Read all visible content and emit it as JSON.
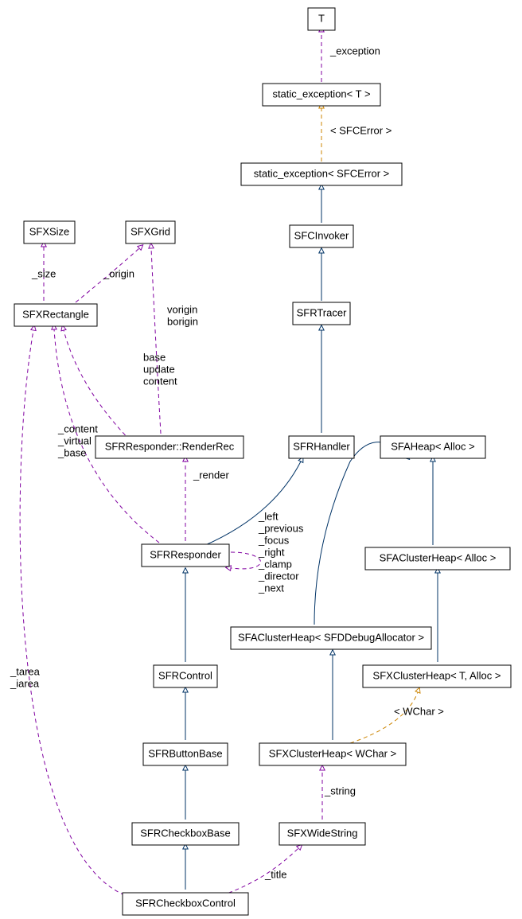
{
  "diagram": {
    "meta": {
      "type": "class-collaboration",
      "title": "SFRCheckboxControl collaboration diagram"
    },
    "nodes": {
      "T": {
        "label": "T"
      },
      "staticExT": {
        "label": "static_exception< T >"
      },
      "staticExSFC": {
        "label": "static_exception< SFCError >"
      },
      "SFCInvoker": {
        "label": "SFCInvoker"
      },
      "SFRTracer": {
        "label": "SFRTracer"
      },
      "SFRHandler": {
        "label": "SFRHandler"
      },
      "RenderRec": {
        "label": "SFRResponder::RenderRec"
      },
      "SFRResponder": {
        "label": "SFRResponder"
      },
      "SFRControl": {
        "label": "SFRControl"
      },
      "SFRButtonBase": {
        "label": "SFRButtonBase"
      },
      "SFRCheckboxBase": {
        "label": "SFRCheckboxBase"
      },
      "SFRCheckboxControl": {
        "label": "SFRCheckboxControl"
      },
      "SFXSize": {
        "label": "SFXSize"
      },
      "SFXGrid": {
        "label": "SFXGrid"
      },
      "SFXRectangle": {
        "label": "SFXRectangle"
      },
      "SFAHeap": {
        "label": "SFAHeap< Alloc >"
      },
      "SFAClusterHeapA": {
        "label": "SFAClusterHeap< Alloc >"
      },
      "SFXClusterHeapTA": {
        "label": "SFXClusterHeap< T, Alloc >"
      },
      "SFAClusterHeapD": {
        "label": "SFAClusterHeap< SFDDebugAllocator >"
      },
      "SFXClusterHeapW": {
        "label": "SFXClusterHeap< WChar >"
      },
      "SFXWideString": {
        "label": "SFXWideString"
      }
    },
    "edgeLabels": {
      "exception": "_exception",
      "sfcError": "< SFCError >",
      "size": "_size",
      "origin": "_origin",
      "vborigin1": "vorigin",
      "vborigin2": "borigin",
      "buc1": "base",
      "buc2": "update",
      "buc3": "content",
      "cvb1": "_content",
      "cvb2": "_virtual",
      "cvb3": "_base",
      "render": "_render",
      "self1": "_left",
      "self2": "_previous",
      "self3": "_focus",
      "self4": "_right",
      "self5": "_clamp",
      "self6": "_director",
      "self7": "_next",
      "tarea1": "_tarea",
      "tarea2": "_iarea",
      "wchar": "< WChar >",
      "string": "_string",
      "title": "_title"
    }
  }
}
